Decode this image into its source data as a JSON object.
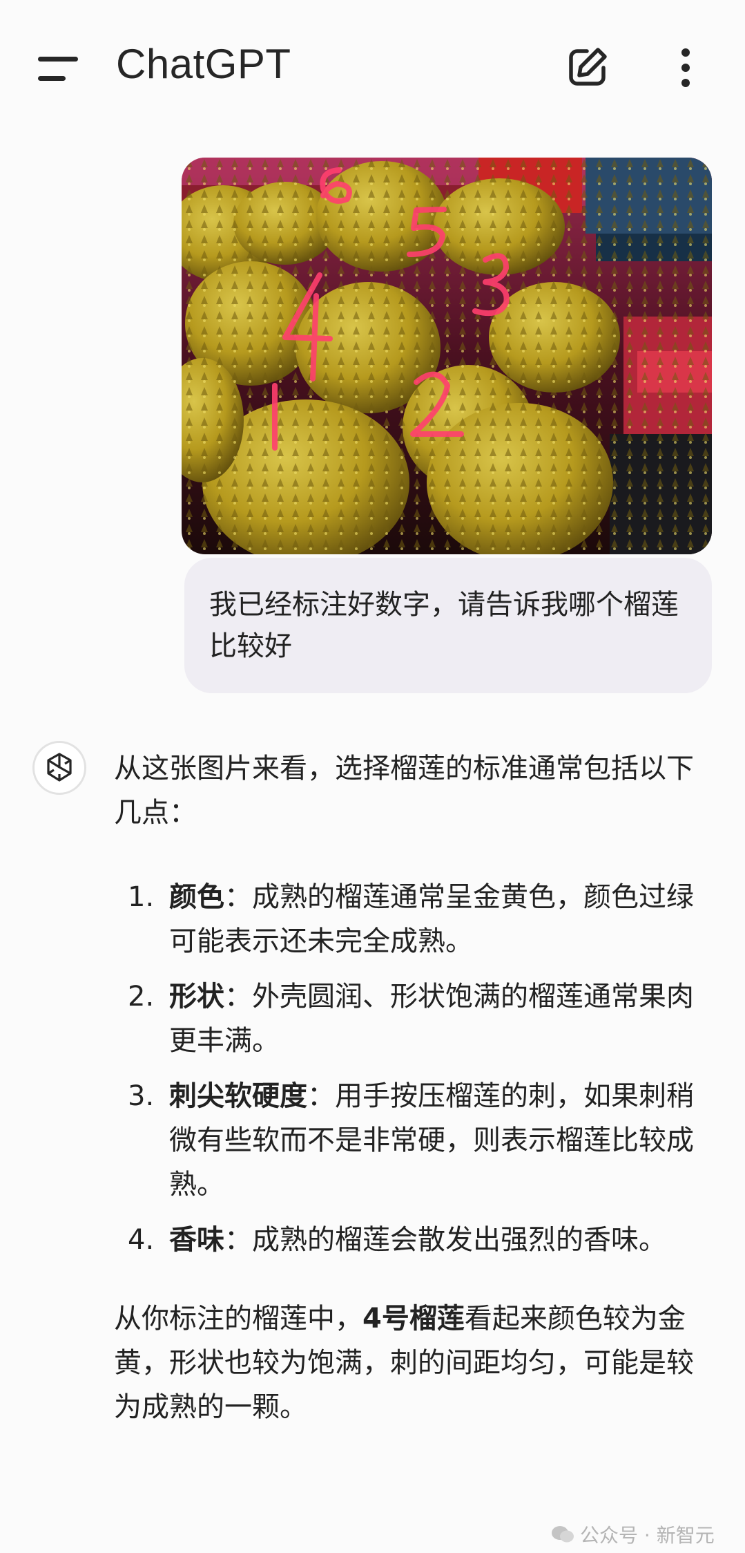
{
  "header": {
    "title": "ChatGPT",
    "icons": {
      "menu": "menu-icon",
      "new_chat": "edit-icon",
      "more": "more-vertical-icon"
    }
  },
  "user_message": {
    "image_labels": [
      "1",
      "2",
      "3",
      "4",
      "5",
      "6"
    ],
    "text": "我已经标注好数字，请告诉我哪个榴莲比较好"
  },
  "assistant_message": {
    "intro": "从这张图片来看，选择榴莲的标准通常包括以下几点：",
    "points": [
      {
        "num": "1.",
        "title": "颜色",
        "sep": "：",
        "body": "成熟的榴莲通常呈金黄色，颜色过绿可能表示还未完全成熟。"
      },
      {
        "num": "2.",
        "title": "形状",
        "sep": "：",
        "body": "外壳圆润、形状饱满的榴莲通常果肉更丰满。"
      },
      {
        "num": "3.",
        "title": "刺尖软硬度",
        "sep": "：",
        "body": "用手按压榴莲的刺，如果刺稍微有些软而不是非常硬，则表示榴莲比较成熟。"
      },
      {
        "num": "4.",
        "title": "香味",
        "sep": "：",
        "body": "成熟的榴莲会散发出强烈的香味。"
      }
    ],
    "conclusion_pre": "从你标注的榴莲中，",
    "conclusion_bold": "4号榴莲",
    "conclusion_post": "看起来颜色较为金黄，形状也较为饱满，刺的间距均匀，可能是较为成熟的一颗。"
  },
  "watermark": {
    "text": "公众号 · 新智元"
  },
  "colors": {
    "background": "#fbfbfb",
    "user_bubble": "#efedf3",
    "annotation": "#e8305a"
  }
}
